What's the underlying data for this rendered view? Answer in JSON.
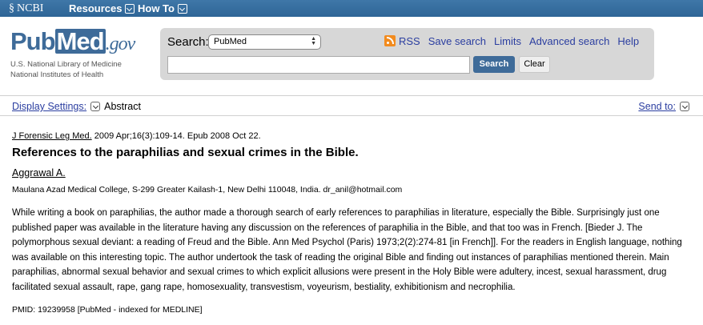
{
  "topbar": {
    "ncbi_label": "NCBI",
    "menus": [
      "Resources",
      "How To"
    ]
  },
  "logo": {
    "pub": "Pub",
    "med": "Med",
    "gov": ".gov",
    "line1": "U.S. National Library of Medicine",
    "line2": "National Institutes of Health"
  },
  "search": {
    "label": "Search:",
    "database": "PubMed",
    "term_value": "",
    "search_button": "Search",
    "clear_button": "Clear"
  },
  "links": {
    "rss": "RSS",
    "save_search": "Save search",
    "limits": "Limits",
    "advanced_search": "Advanced search",
    "help": "Help"
  },
  "settings": {
    "display_settings": "Display Settings:",
    "format": "Abstract",
    "send_to": "Send to:"
  },
  "article": {
    "journal": "J Forensic Leg Med.",
    "citation": " 2009 Apr;16(3):109-14. Epub 2008 Oct 22.",
    "title": "References to the paraphilias and sexual crimes in the Bible.",
    "author": "Aggrawal A.",
    "affiliation": "Maulana Azad Medical College, S-299 Greater Kailash-1, New Delhi 110048, India. dr_anil@hotmail.com",
    "abstract": "While writing a book on paraphilias, the author made a thorough search of early references to paraphilias in literature, especially the Bible. Surprisingly just one published paper was available in the literature having any discussion on the references of paraphilia in the Bible, and that too was in French. [Bieder J. The polymorphous sexual deviant: a reading of Freud and the Bible. Ann Med Psychol (Paris) 1973;2(2):274-81 [in French]]. For the readers in English language, nothing was available on this interesting topic. The author undertook the task of reading the original Bible and finding out instances of paraphilias mentioned therein. Main paraphilias, abnormal sexual behavior and sexual crimes to which explicit allusions were present in the Holy Bible were adultery, incest, sexual harassment, drug facilitated sexual assault, rape, gang rape, homosexuality, transvestism, voyeurism, bestiality, exhibitionism and necrophilia.",
    "pmid": "PMID: 19239958 [PubMed - indexed for MEDLINE]"
  }
}
